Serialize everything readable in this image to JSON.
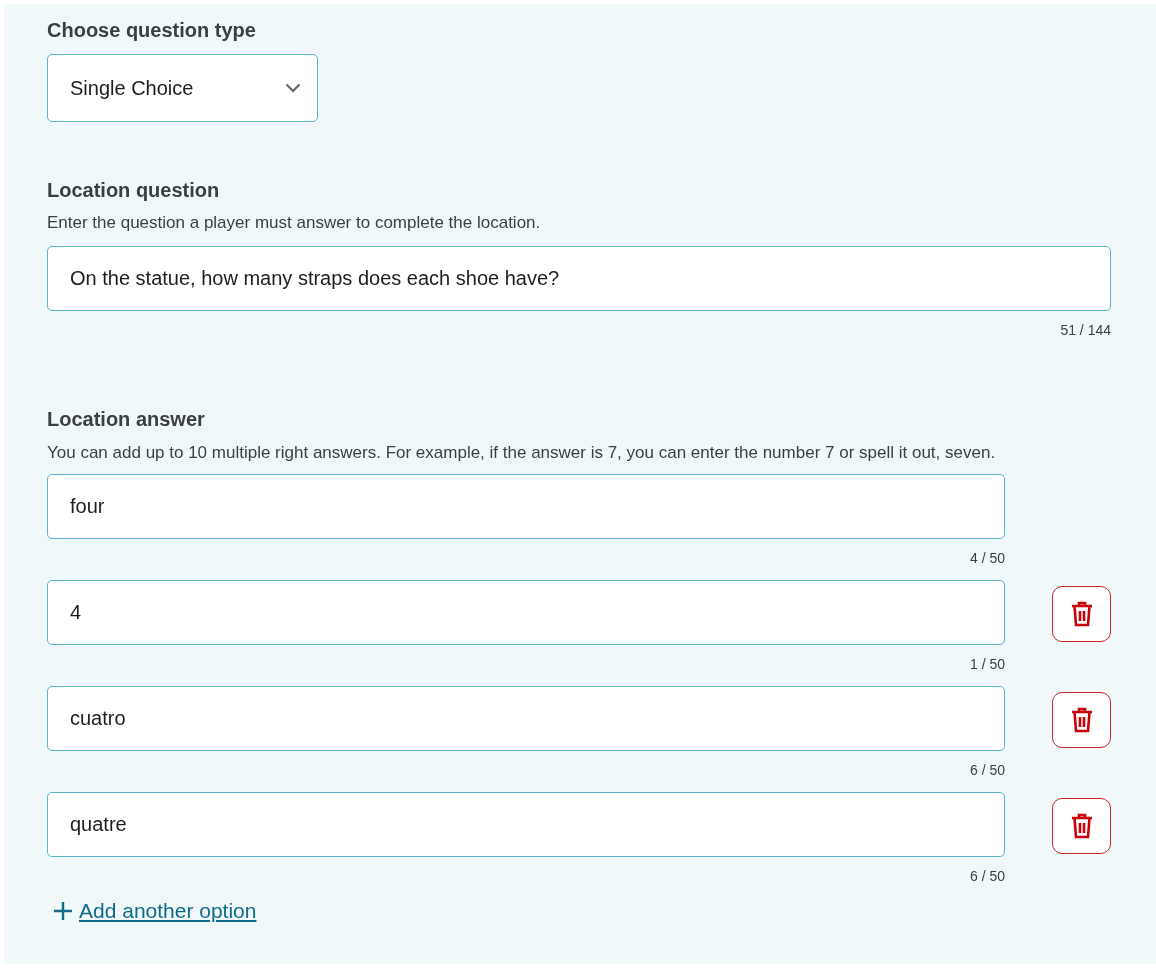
{
  "question_type": {
    "label": "Choose question type",
    "value": "Single Choice"
  },
  "location_question": {
    "heading": "Location question",
    "description": "Enter the question a player must answer to complete the location.",
    "value": "On the statue, how many straps does each shoe have?",
    "counter": "51 / 144"
  },
  "location_answer": {
    "heading": "Location answer",
    "description": "You can add up to 10 multiple right answers. For example, if the answer is 7, you can enter the number 7 or spell it out, seven.",
    "answers": [
      {
        "value": "four",
        "counter": "4 / 50",
        "deletable": false
      },
      {
        "value": "4",
        "counter": "1 / 50",
        "deletable": true
      },
      {
        "value": "cuatro",
        "counter": "6 / 50",
        "deletable": true
      },
      {
        "value": "quatre",
        "counter": "6 / 50",
        "deletable": true
      }
    ],
    "add_link": "Add another option"
  }
}
